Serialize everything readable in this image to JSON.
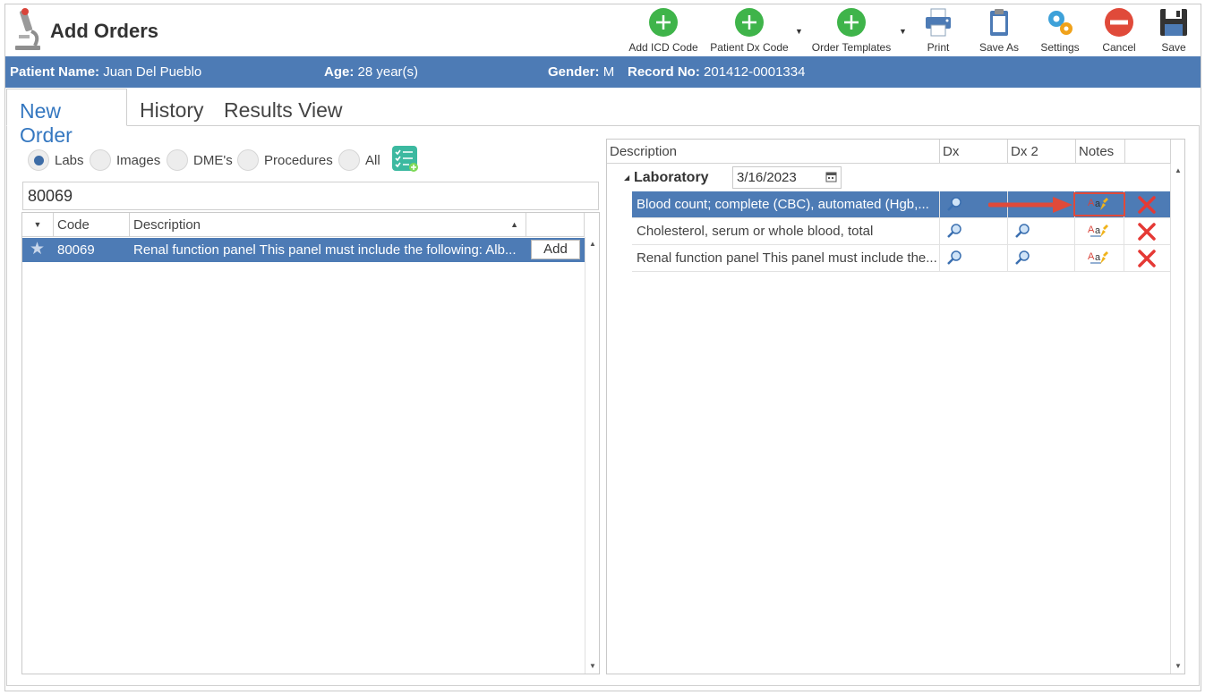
{
  "app": {
    "title": "Add Orders"
  },
  "toolbar": {
    "add_icd_code": "Add ICD Code",
    "patient_dx_code": "Patient Dx Code",
    "order_templates": "Order Templates",
    "print": "Print",
    "save_as": "Save As",
    "settings": "Settings",
    "cancel": "Cancel",
    "save": "Save"
  },
  "patient": {
    "name_label": "Patient Name:",
    "name": "Juan Del Pueblo",
    "age_label": "Age:",
    "age": "28 year(s)",
    "gender_label": "Gender:",
    "gender": "M",
    "record_label": "Record No:",
    "record": "201412-0001334"
  },
  "tabs": [
    {
      "label": "New Order",
      "active": true
    },
    {
      "label": "History",
      "active": false
    },
    {
      "label": "Results View",
      "active": false
    }
  ],
  "filters": {
    "options": [
      "Labs",
      "Images",
      "DME's",
      "Procedures",
      "All"
    ],
    "selected": "Labs"
  },
  "search": {
    "value": "80069"
  },
  "search_results": {
    "columns": [
      "Code",
      "Description"
    ],
    "rows": [
      {
        "code": "80069",
        "description": "Renal function panel This panel must include the following: Alb...",
        "action": "Add"
      }
    ]
  },
  "orders": {
    "columns": [
      "Description",
      "Dx",
      "Dx 2",
      "Notes"
    ],
    "group": {
      "label": "Laboratory",
      "date": "3/16/2023"
    },
    "rows": [
      {
        "description": "Blood count; complete (CBC), automated (Hgb,...",
        "selected": true
      },
      {
        "description": "Cholesterol, serum or whole blood, total",
        "selected": false
      },
      {
        "description": "Renal function panel This panel must include the...",
        "selected": false
      }
    ]
  },
  "colors": {
    "accent": "#4d7bb5",
    "tab_active": "#3477c0",
    "add_green": "#3fb44a",
    "cancel_red": "#e04a3a",
    "delete_red": "#e53935"
  }
}
